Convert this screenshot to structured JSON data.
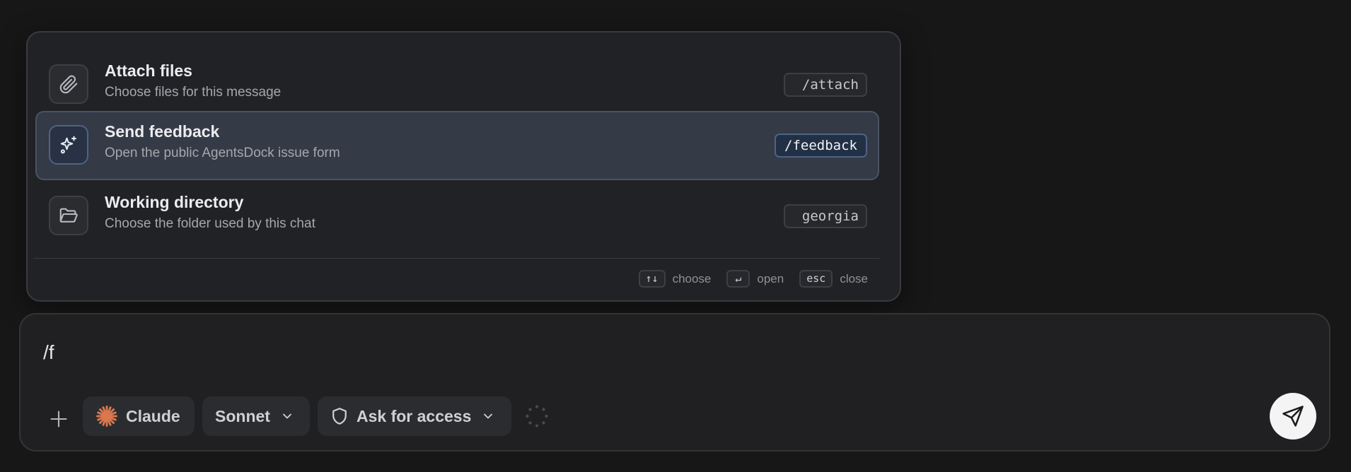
{
  "palette": {
    "items": [
      {
        "icon": "paperclip-icon",
        "title": "Attach files",
        "description": "Choose files for this message",
        "shortcut": "/attach",
        "active": false
      },
      {
        "icon": "sparkles-icon",
        "title": "Send feedback",
        "description": "Open the public AgentsDock issue form",
        "shortcut": "/feedback",
        "active": true
      },
      {
        "icon": "folder-open-icon",
        "title": "Working directory",
        "description": "Choose the folder used by this chat",
        "shortcut": "georgia",
        "active": false
      }
    ],
    "hints": [
      {
        "key": "↑↓",
        "label": "choose"
      },
      {
        "key": "↵",
        "label": "open"
      },
      {
        "key": "esc",
        "label": "close"
      }
    ]
  },
  "composer": {
    "input_value": "/f",
    "agent_label": "Claude",
    "model_label": "Sonnet",
    "access_label": "Ask for access"
  },
  "colors": {
    "background": "#171717",
    "palette_bg": "#212225",
    "active_row_bg": "#343a46",
    "active_accent": "#4e6485",
    "claude_orange": "#d9774f",
    "send_button_bg": "#f4f4f5"
  }
}
